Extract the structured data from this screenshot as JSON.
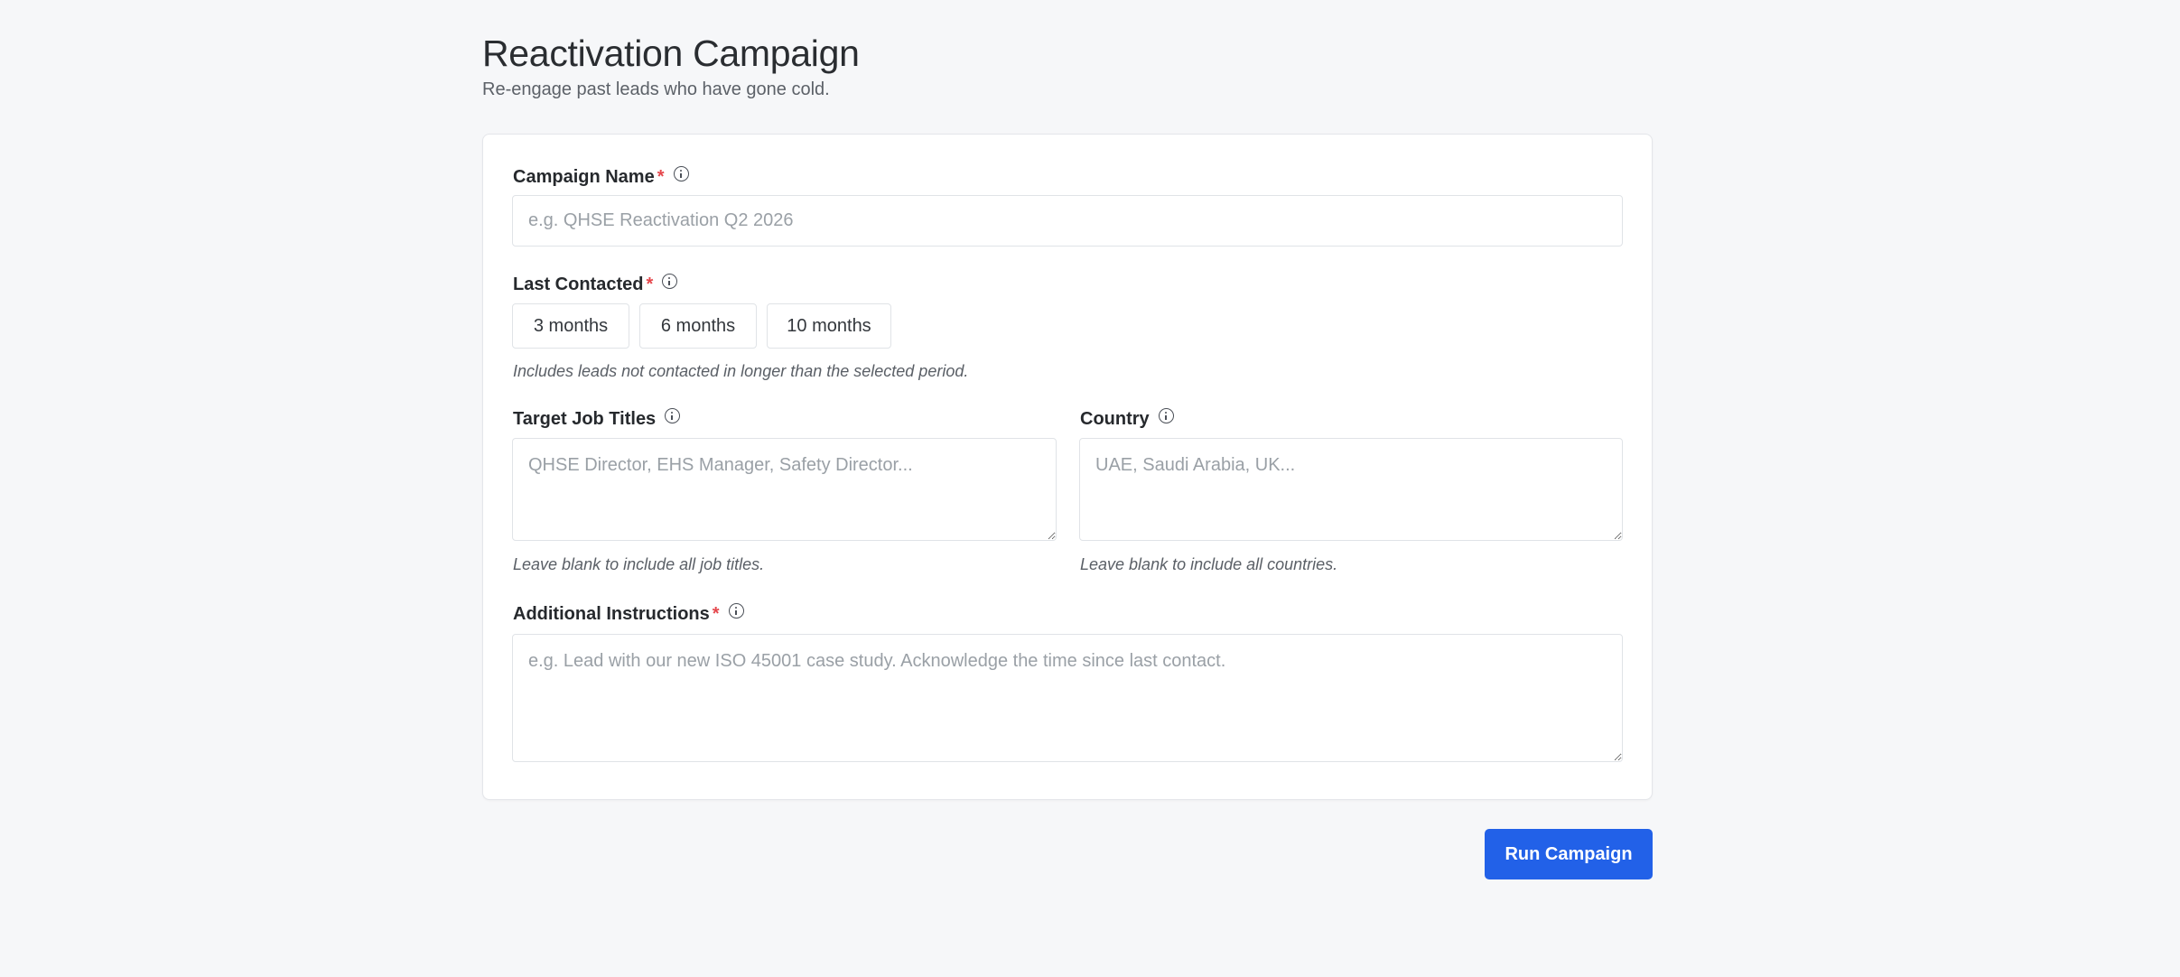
{
  "header": {
    "title": "Reactivation Campaign",
    "subtitle": "Re-engage past leads who have gone cold."
  },
  "form": {
    "campaign_name": {
      "label": "Campaign Name",
      "required_mark": "*",
      "value": "",
      "placeholder": "e.g. QHSE Reactivation Q2 2026"
    },
    "last_contacted": {
      "label": "Last Contacted",
      "required_mark": "*",
      "options": [
        "3 months",
        "6 months",
        "10 months"
      ],
      "hint": "Includes leads not contacted in longer than the selected period."
    },
    "target_job_titles": {
      "label": "Target Job Titles",
      "value": "",
      "placeholder": "QHSE Director, EHS Manager, Safety Director...",
      "hint": "Leave blank to include all job titles."
    },
    "country": {
      "label": "Country",
      "value": "",
      "placeholder": "UAE, Saudi Arabia, UK...",
      "hint": "Leave blank to include all countries."
    },
    "additional_instructions": {
      "label": "Additional Instructions",
      "required_mark": "*",
      "value": "",
      "placeholder": "e.g. Lead with our new ISO 45001 case study. Acknowledge the time since last contact."
    }
  },
  "actions": {
    "run_label": "Run Campaign"
  },
  "colors": {
    "accent": "#2261e8",
    "required": "#e5484d",
    "background": "#f6f7f9"
  },
  "icons": {
    "field_info": "info-circle-icon"
  }
}
